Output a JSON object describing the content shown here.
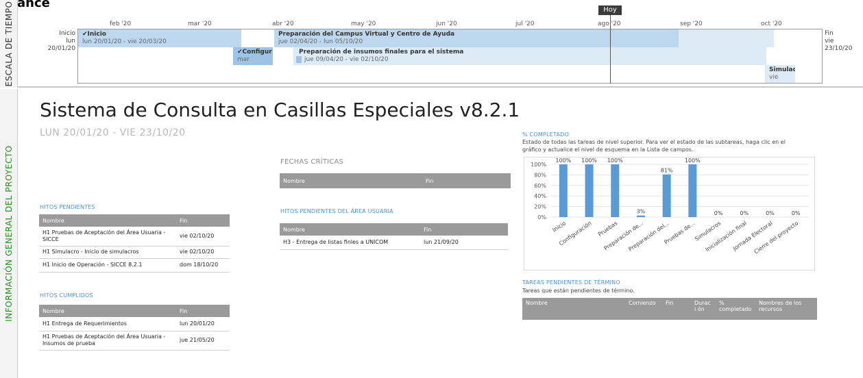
{
  "page": {
    "top_title": "Avance"
  },
  "timeline": {
    "side_label": "ESCALA DE TIEMPO",
    "months": [
      "feb '20",
      "mar '20",
      "abr '20",
      "may '20",
      "jun '20",
      "jul '20",
      "ago '20",
      "sep '20",
      "oct '20"
    ],
    "start": {
      "label": "Inicio",
      "date": "lun 20/01/20"
    },
    "end": {
      "label": "Fin",
      "date": "vie 23/10/20"
    },
    "today": "Hoy",
    "bars": [
      {
        "title": "✔Inicio",
        "sub": "lun 20/01/20 - vie 20/03/20"
      },
      {
        "title": "Preparación del Campus Virtual y Centro de Ayuda",
        "sub": "jue 02/04/20 - lun 05/10/20"
      },
      {
        "title": "✔Configur",
        "sub": "mar"
      },
      {
        "title": "Preparación de insumos finales para el sistema",
        "sub": "jue 09/04/20 - vie 02/10/20"
      },
      {
        "title": "Simulacr",
        "sub": "vie"
      }
    ]
  },
  "info": {
    "side_label": "INFORMACIÓN GENERAL DEL PROYECTO",
    "title": "Sistema de Consulta en Casillas Especiales v8.2.1",
    "dates": "LUN 20/01/20 - VIE 23/10/20"
  },
  "hitos_pendientes": {
    "heading": "HITOS PENDIENTES",
    "columns": [
      "Nombre",
      "Fin"
    ],
    "rows": [
      {
        "name": "H1 Pruebas de Aceptación del Área Usuaria - SICCE",
        "fin": "vie 02/10/20"
      },
      {
        "name": "H1 Simulacro - Inicio de simulacros",
        "fin": "vie 02/10/20"
      },
      {
        "name": "H1 Inicio de Operación - SICCE 8.2.1",
        "fin": "dom 18/10/20"
      }
    ]
  },
  "hitos_cumplidos": {
    "heading": "HITOS CUMPLIDOS",
    "columns": [
      "Nombre",
      "Fin"
    ],
    "rows": [
      {
        "name": "H1 Entrega de Requerimientos",
        "fin": "lun 20/01/20"
      },
      {
        "name": "H1 Pruebas de Aceptación del Área Usuaria - Insumos de prueba",
        "fin": "jue 21/05/20"
      }
    ]
  },
  "fechas_criticas": {
    "heading": "FECHAS CRÍTICAS",
    "columns": [
      "Nombre",
      "Fin"
    ]
  },
  "hitos_usuaria": {
    "heading": "HITOS PENDIENTES DEL ÁREA USUARIA",
    "columns": [
      "Nombre",
      "Fin"
    ],
    "rows": [
      {
        "name": "H3 - Entrega de listas finles a UNICOM",
        "fin": "lun 21/09/20"
      }
    ]
  },
  "completado": {
    "heading": "% COMPLETADO",
    "description": "Estado de todas las tareas de nivel superior. Para ver el estado de las subtareas, haga clic en el gráfico y actualice el nivel de esquema en la Lista de campos."
  },
  "chart_data": {
    "type": "bar",
    "categories": [
      "Inicio",
      "Configuración",
      "Pruebas",
      "Preparación de...",
      "Preparación del...",
      "Pruebas de...",
      "Simulacros",
      "Inicialización final",
      "Jornada Electoral",
      "Cierre del proyecto"
    ],
    "values": [
      100,
      100,
      100,
      3,
      81,
      100,
      0,
      0,
      0,
      0
    ],
    "data_labels": [
      "100%",
      "100%",
      "100%",
      "3%",
      "81%",
      "100%",
      "0%",
      "0%",
      "0%",
      "0%"
    ],
    "ytick_labels": [
      "100%",
      "80%",
      "60%",
      "40%",
      "20%",
      "0%"
    ],
    "ylim": [
      0,
      100
    ],
    "bar_color": "#5b9bd5",
    "grid": true
  },
  "tareas_pendientes": {
    "heading": "TAREAS PENDIENTES DE TÉRMINO",
    "description": "Tareas que están pendientes de término.",
    "columns": [
      "Nombre",
      "Comienzo",
      "Fin",
      "Duraci ón",
      "% completado",
      "Nombres de los recursos"
    ]
  },
  "colors": {
    "bar_light": "#bdd7ee",
    "bar_lighter": "#ddebf7",
    "bar_mid": "#9dc3e6",
    "header_gray": "#9a9a9a",
    "accent_blue": "#4a90d9",
    "side_green": "#2e8b2e"
  }
}
